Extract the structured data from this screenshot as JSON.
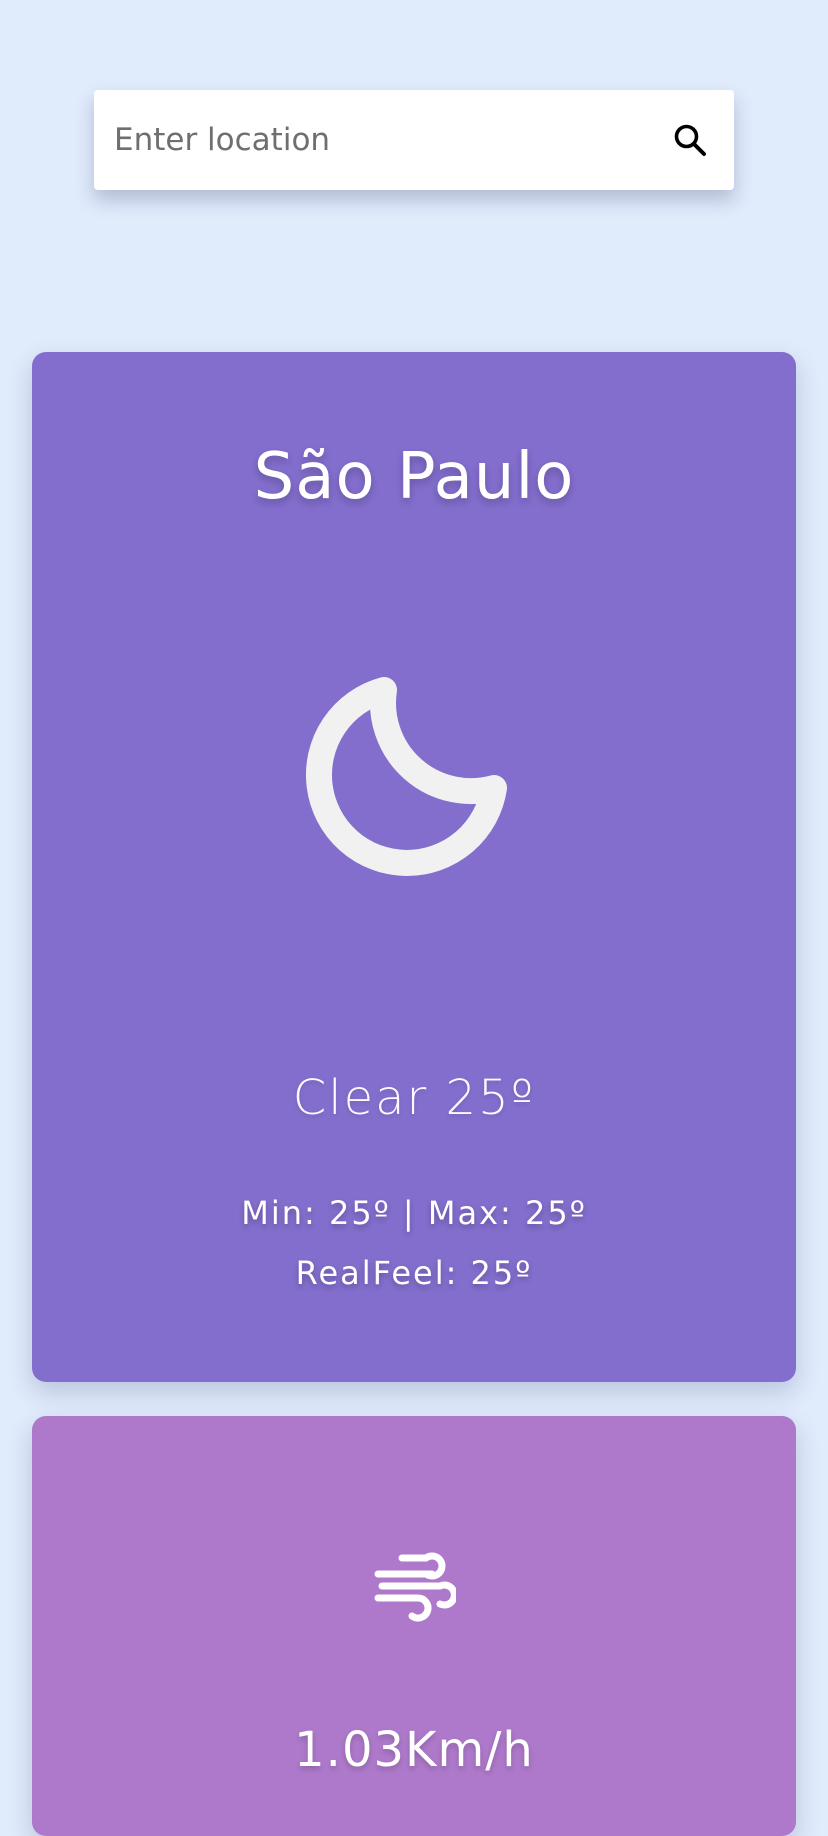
{
  "search": {
    "placeholder": "Enter location",
    "value": "",
    "icon": "search-icon"
  },
  "weather": {
    "city": "São Paulo",
    "icon": "moon-icon",
    "condition": "Clear 25º",
    "minmax": "Min: 25º | Max: 25º",
    "realfeel": "RealFeel: 25º",
    "card_color": "#836ecd"
  },
  "wind": {
    "icon": "wind-icon",
    "speed": "1.03Km/h",
    "card_color": "#ae79cb"
  },
  "colors": {
    "background": "#e0ebfc",
    "icon_fill": "#f1f1f1"
  }
}
